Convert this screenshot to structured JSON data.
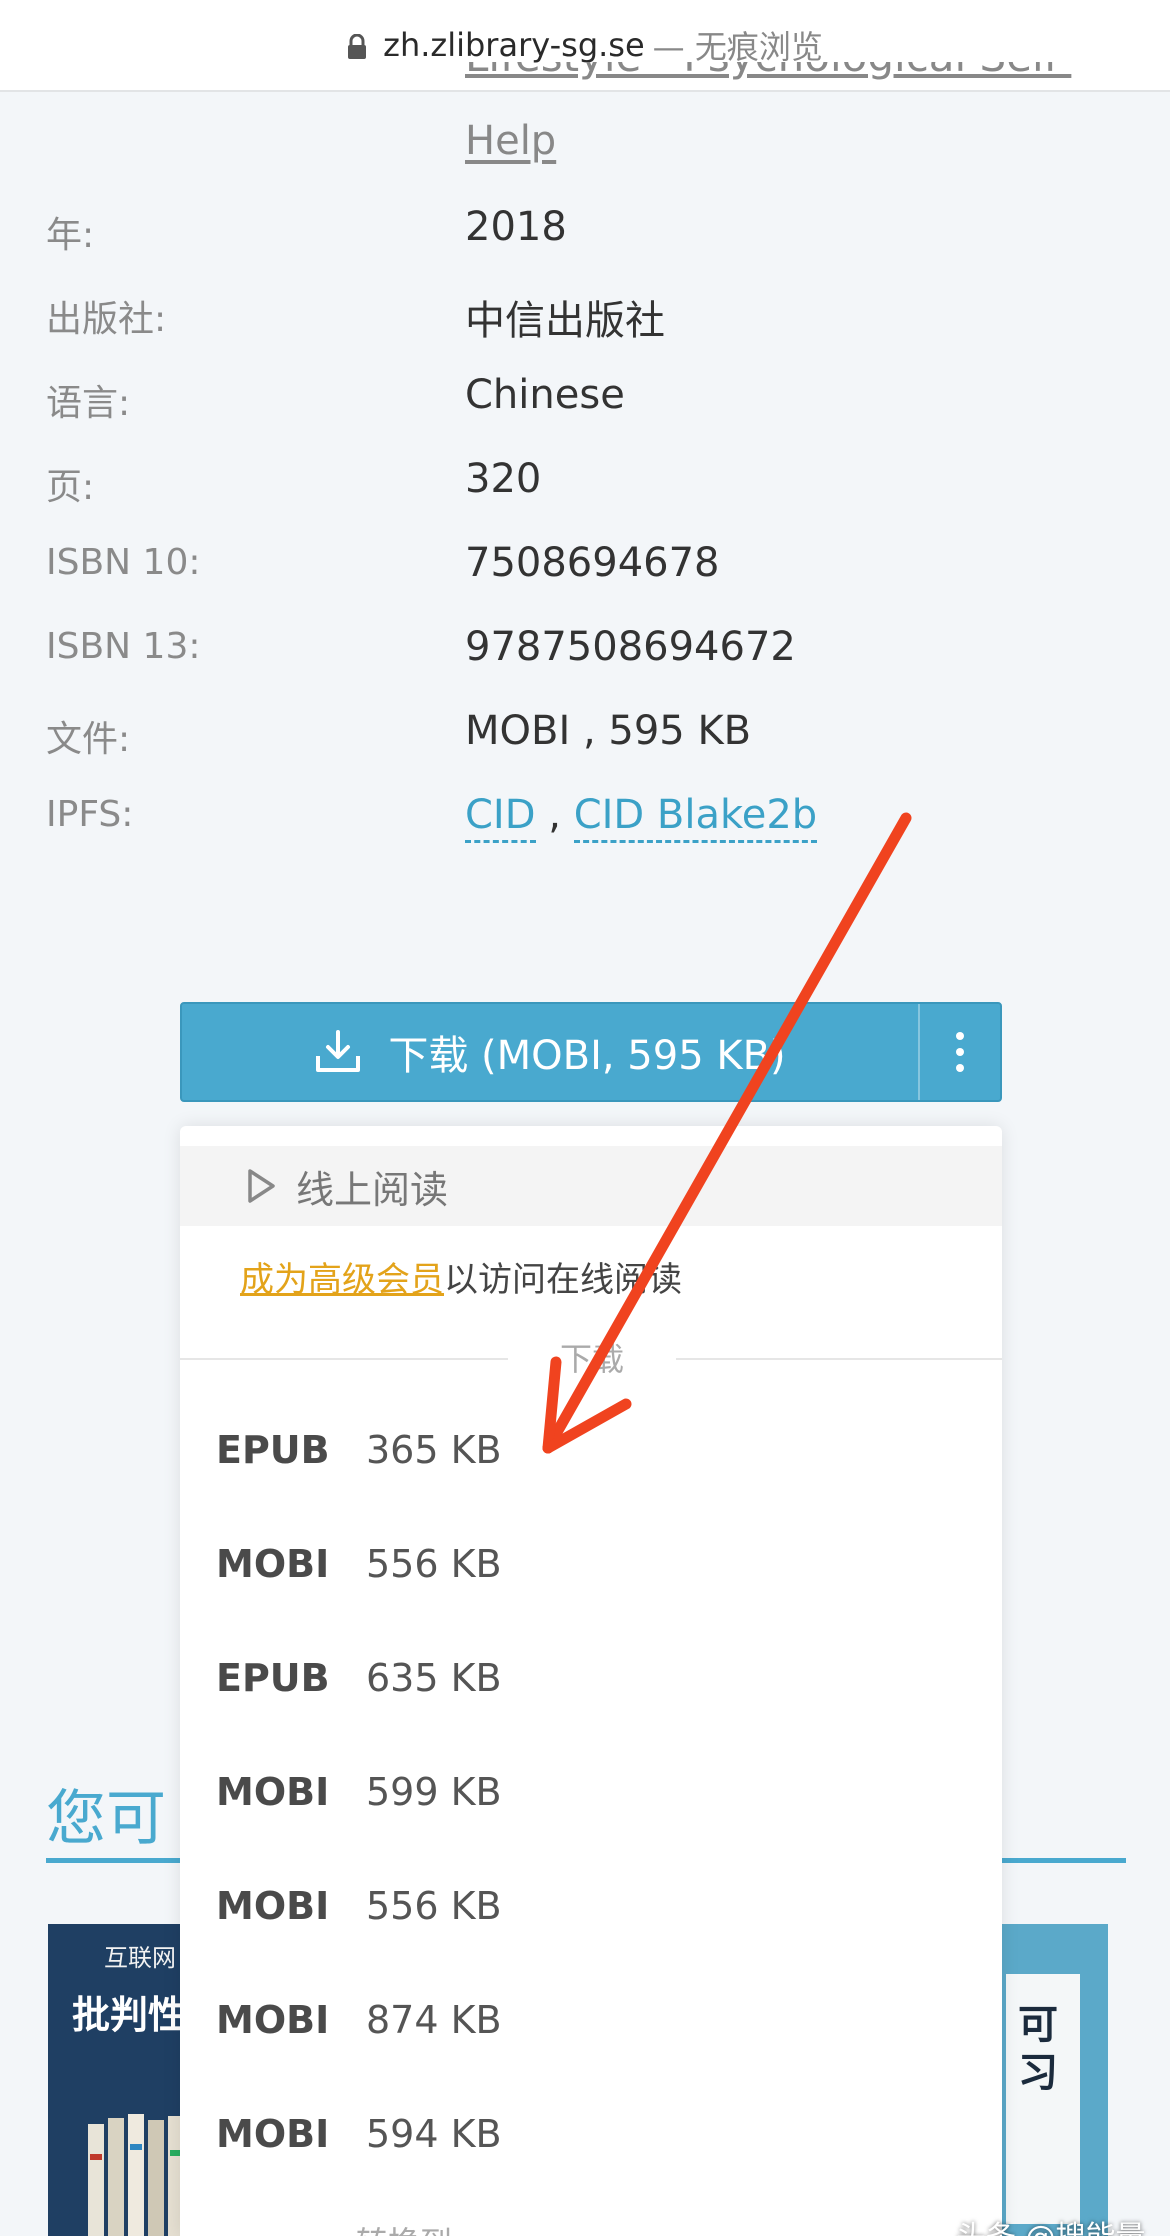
{
  "browser": {
    "host": "zh.zlibrary-sg.se",
    "mode": "— 无痕浏览"
  },
  "details": {
    "category_tail": "Lifestyle - Psychological Self-",
    "category_help": "Help",
    "rows": [
      {
        "label": "年:",
        "value": "2018"
      },
      {
        "label": "出版社:",
        "value": "中信出版社"
      },
      {
        "label": "语言:",
        "value": "Chinese"
      },
      {
        "label": "页:",
        "value": "320"
      },
      {
        "label": "ISBN 10:",
        "value": "7508694678"
      },
      {
        "label": "ISBN 13:",
        "value": "9787508694672"
      },
      {
        "label": "文件:",
        "value": "MOBI , 595 KB"
      }
    ],
    "ipfs": {
      "label": "IPFS:",
      "cid": "CID",
      "separator": " , ",
      "cid_blake": "CID Blake2b"
    }
  },
  "download": {
    "label": "下载 (MOBI, 595 KB)",
    "online_read": "线上阅读",
    "premium_link": "成为高级会员",
    "premium_suffix": "以访问在线阅读",
    "section_title": "下载",
    "formats": [
      {
        "format": "EPUB",
        "size": "365 KB"
      },
      {
        "format": "MOBI",
        "size": "556 KB"
      },
      {
        "format": "EPUB",
        "size": "635 KB"
      },
      {
        "format": "MOBI",
        "size": "599 KB"
      },
      {
        "format": "MOBI",
        "size": "556 KB"
      },
      {
        "format": "MOBI",
        "size": "874 KB"
      },
      {
        "format": "MOBI",
        "size": "594 KB"
      }
    ],
    "convert_title": "转换到"
  },
  "recommend": {
    "heading_visible": "您可",
    "left_book_top": "互联网",
    "left_book_title": "批判性",
    "right_book_chars": [
      "可",
      "习"
    ]
  },
  "watermark": "头条 @搜能量",
  "colors": {
    "accent": "#49a9cf",
    "premium": "#e3a31a",
    "arrow": "#f0431f"
  }
}
